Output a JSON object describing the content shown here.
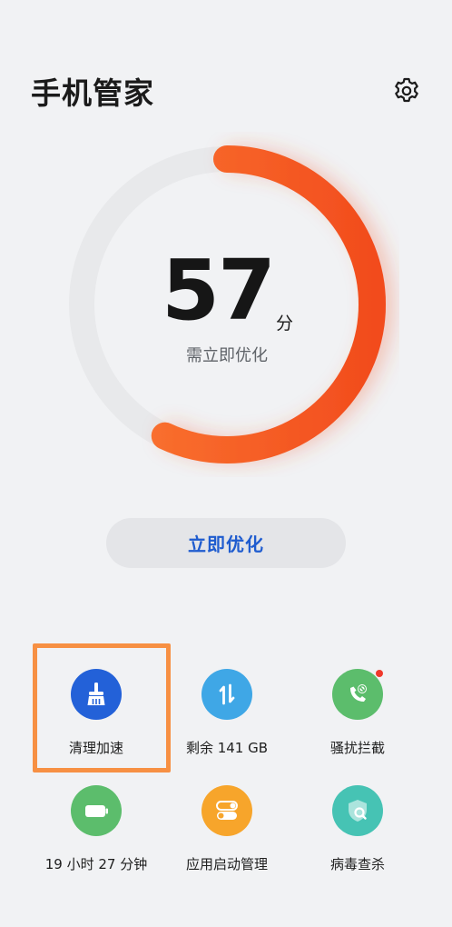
{
  "header": {
    "title": "手机管家"
  },
  "score": {
    "value": 57,
    "unit": "分",
    "status": "需立即优化",
    "max": 100,
    "arc_color": "#f45a24",
    "track_color": "#e8e9eb"
  },
  "action": {
    "optimize_label": "立即优化"
  },
  "tiles": [
    {
      "label": "清理加速",
      "icon": "broom-icon",
      "color": "#2361d8",
      "selected": true
    },
    {
      "label": "剩余 141 GB",
      "icon": "storage-transfer-icon",
      "color": "#3fa7e6"
    },
    {
      "label": "骚扰拦截",
      "icon": "blocked-call-icon",
      "color": "#5cbd6c",
      "badge": true
    },
    {
      "label": "19 小时 27 分钟",
      "icon": "battery-icon",
      "color": "#5cbd6c"
    },
    {
      "label": "应用启动管理",
      "icon": "app-launch-toggle-icon",
      "color": "#f7a52b"
    },
    {
      "label": "病毒查杀",
      "icon": "virus-scan-shield-icon",
      "color": "#46c3b4"
    }
  ]
}
